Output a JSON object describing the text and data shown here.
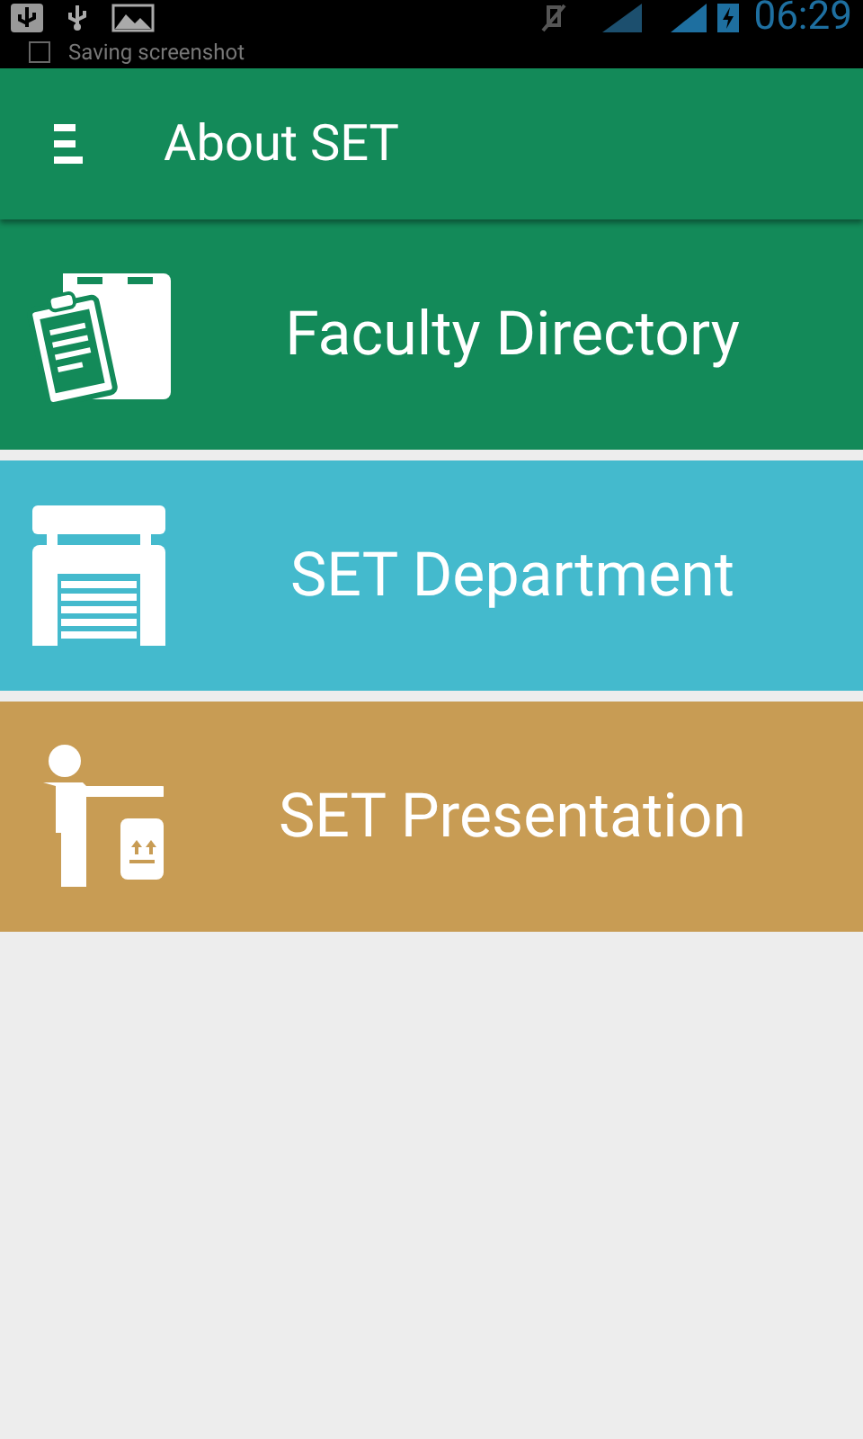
{
  "status_bar": {
    "time": "06:29",
    "notification": "Saving screenshot"
  },
  "toolbar": {
    "title": "About SET"
  },
  "menu": [
    {
      "label": "Faculty Directory",
      "kind": "clipboard",
      "color": "#138a59"
    },
    {
      "label": "SET Department",
      "kind": "garage",
      "color": "#44bacd"
    },
    {
      "label": "SET Presentation",
      "kind": "presenter",
      "color": "#c89c54"
    }
  ]
}
